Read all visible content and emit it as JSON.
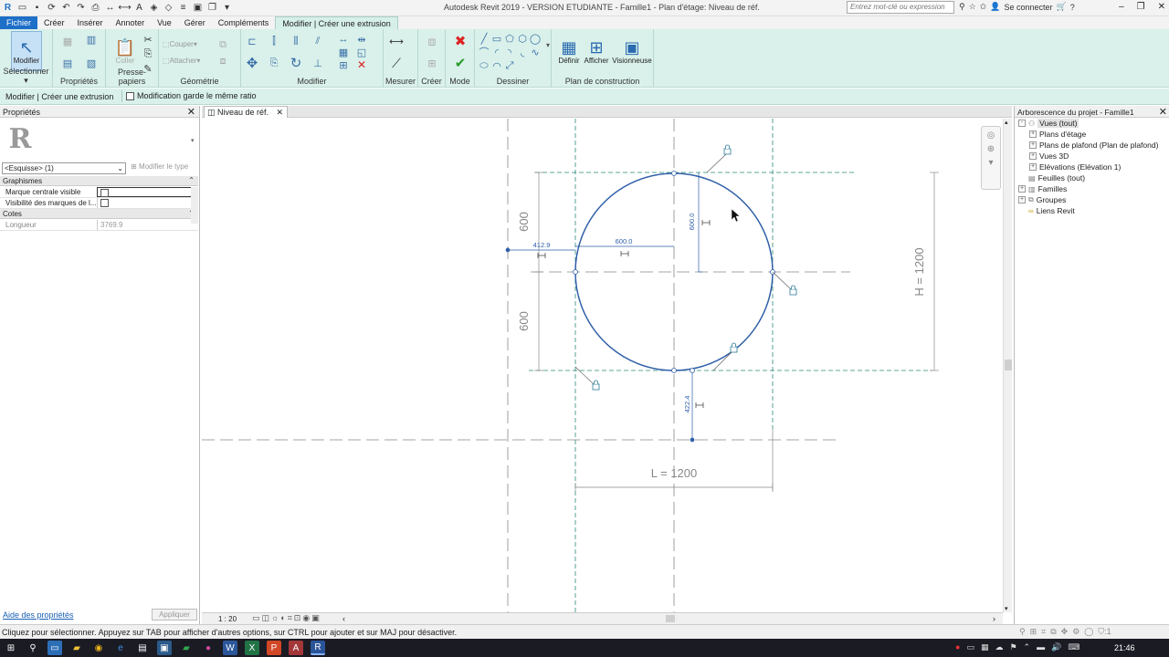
{
  "window": {
    "title": "Autodesk Revit 2019 - VERSION ETUDIANTE -  Famille1 - Plan d'étage: Niveau de réf.",
    "search_placeholder": "Entrez mot-clé ou expression",
    "sign_in": "Se connecter"
  },
  "tabs": [
    "Fichier",
    "Créer",
    "Insérer",
    "Annoter",
    "Vue",
    "Gérer",
    "Compléments",
    "Modifier | Créer une extrusion"
  ],
  "ribbon": {
    "panels": {
      "select": "Sélectionner",
      "properties": "Propriétés",
      "clipboard": "Presse-papiers",
      "geometry": "Géométrie",
      "modify": "Modifier",
      "measure": "Mesurer",
      "create": "Créer",
      "mode": "Mode",
      "draw": "Dessiner",
      "workplane": "Plan de construction"
    },
    "modify_btn": "Modifier",
    "paste": "Coller",
    "cut": "Couper",
    "join": "Attacher",
    "set": "Définir",
    "show": "Afficher",
    "viewer": "Visionneuse"
  },
  "context_bar": {
    "label": "Modifier | Créer une extrusion",
    "keep_ratio": "Modification garde le même ratio"
  },
  "properties": {
    "title": "Propriétés",
    "type_selector": "<Esquisse> (1)",
    "edit_type": "Modifier le type",
    "sections": [
      {
        "name": "Graphismes",
        "rows": [
          {
            "key": "Marque centrale visible",
            "value": ""
          },
          {
            "key": "Visibilité des marques de l...",
            "value": ""
          }
        ]
      },
      {
        "name": "Cotes",
        "rows": [
          {
            "key": "Longueur",
            "value": "3769.9"
          }
        ]
      }
    ],
    "help_link": "Aide des propriétés",
    "apply": "Appliquer"
  },
  "view": {
    "tab_name": "Niveau de réf.",
    "scale": "1 : 20",
    "dims": {
      "left_top": "600",
      "left_bottom": "600",
      "height": "H = 1200",
      "length": "L = 1200",
      "radius_horizontal": "600.0",
      "radius_vertical": "600.0",
      "left_offset": "412.9",
      "bottom_offset": "422.4"
    }
  },
  "browser": {
    "title": "Arborescence du projet - Famille1",
    "items": [
      {
        "label": "Vues (tout)",
        "level": 0,
        "pm": "-",
        "sel": true
      },
      {
        "label": "Plans d'étage",
        "level": 1,
        "pm": "+"
      },
      {
        "label": "Plans de plafond (Plan de plafond)",
        "level": 1,
        "pm": "+"
      },
      {
        "label": "Vues 3D",
        "level": 1,
        "pm": "+"
      },
      {
        "label": "Elévations (Elévation 1)",
        "level": 1,
        "pm": "+"
      },
      {
        "label": "Feuilles (tout)",
        "level": 0,
        "pm": ""
      },
      {
        "label": "Familles",
        "level": 0,
        "pm": "+"
      },
      {
        "label": "Groupes",
        "level": 0,
        "pm": "+"
      },
      {
        "label": "Liens Revit",
        "level": 0,
        "pm": ""
      }
    ]
  },
  "status": {
    "message": "Cliquez pour sélectionner. Appuyez sur TAB pour afficher d'autres options, sur CTRL pour ajouter et sur MAJ pour désactiver.",
    "filter_count": ":1"
  },
  "taskbar": {
    "time": "21:46"
  },
  "colors": {
    "accent": "#1e6fc8",
    "ribbon_bg": "#d9f1ea",
    "sketch_line": "#2f5fa8",
    "ref_plane": "#2a8a7a"
  }
}
